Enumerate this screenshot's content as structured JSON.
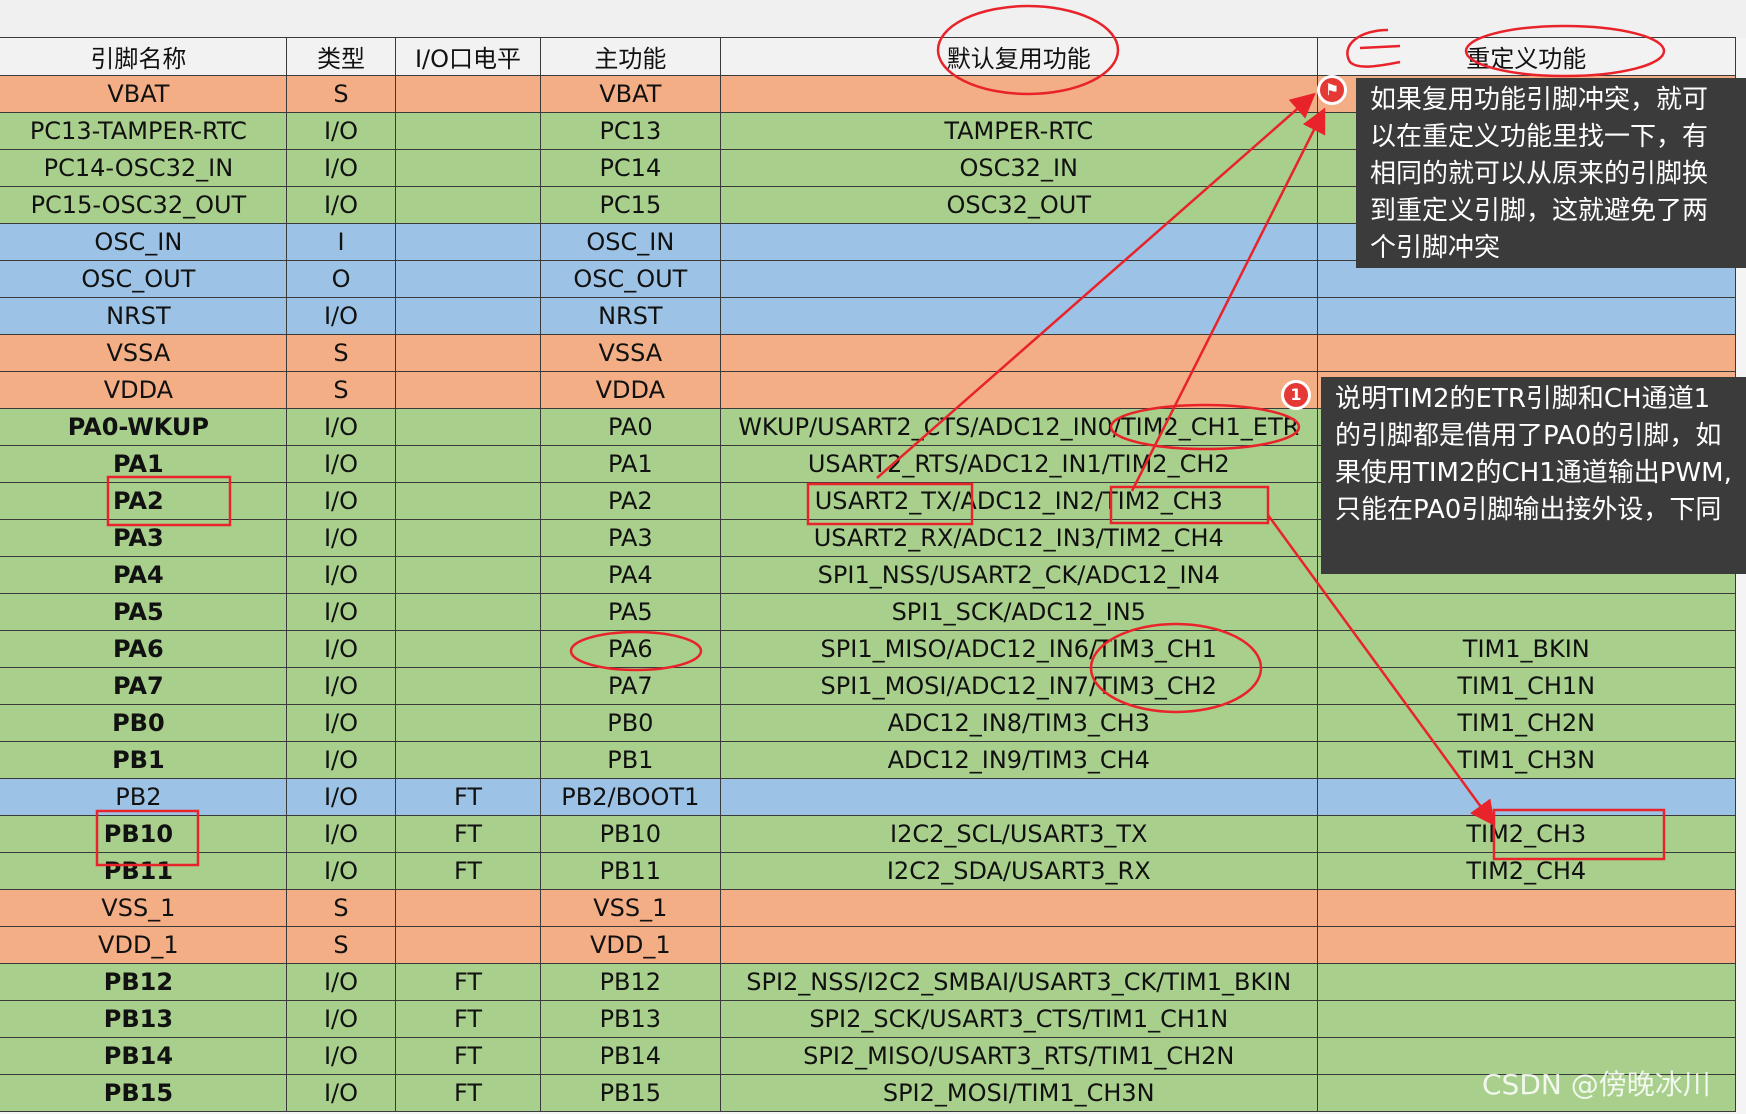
{
  "table": {
    "headers": [
      "引脚名称",
      "类型",
      "I/O口电平",
      "主功能",
      "默认复用功能",
      "重定义功能"
    ],
    "rows": [
      {
        "c": "orange",
        "name": "VBAT",
        "type": "S",
        "level": "",
        "main": "VBAT",
        "alt": "",
        "remap": ""
      },
      {
        "c": "green",
        "name": "PC13-TAMPER-RTC",
        "type": "I/O",
        "level": "",
        "main": "PC13",
        "alt": "TAMPER-RTC",
        "remap": ""
      },
      {
        "c": "green",
        "name": "PC14-OSC32_IN",
        "type": "I/O",
        "level": "",
        "main": "PC14",
        "alt": "OSC32_IN",
        "remap": ""
      },
      {
        "c": "green",
        "name": "PC15-OSC32_OUT",
        "type": "I/O",
        "level": "",
        "main": "PC15",
        "alt": "OSC32_OUT",
        "remap": ""
      },
      {
        "c": "blue",
        "name": "OSC_IN",
        "type": "I",
        "level": "",
        "main": "OSC_IN",
        "alt": "",
        "remap": ""
      },
      {
        "c": "blue",
        "name": "OSC_OUT",
        "type": "O",
        "level": "",
        "main": "OSC_OUT",
        "alt": "",
        "remap": ""
      },
      {
        "c": "blue",
        "name": "NRST",
        "type": "I/O",
        "level": "",
        "main": "NRST",
        "alt": "",
        "remap": ""
      },
      {
        "c": "orange",
        "name": "VSSA",
        "type": "S",
        "level": "",
        "main": "VSSA",
        "alt": "",
        "remap": ""
      },
      {
        "c": "orange",
        "name": "VDDA",
        "type": "S",
        "level": "",
        "main": "VDDA",
        "alt": "",
        "remap": ""
      },
      {
        "c": "green",
        "name": "PA0-WKUP",
        "type": "I/O",
        "level": "",
        "main": "PA0",
        "alt": "WKUP/USART2_CTS/ADC12_IN0/TIM2_CH1_ETR",
        "remap": "",
        "b": true
      },
      {
        "c": "green",
        "name": "PA1",
        "type": "I/O",
        "level": "",
        "main": "PA1",
        "alt": "USART2_RTS/ADC12_IN1/TIM2_CH2",
        "remap": "",
        "b": true
      },
      {
        "c": "green",
        "name": "PA2",
        "type": "I/O",
        "level": "",
        "main": "PA2",
        "alt": "USART2_TX/ADC12_IN2/TIM2_CH3",
        "remap": "",
        "b": true
      },
      {
        "c": "green",
        "name": "PA3",
        "type": "I/O",
        "level": "",
        "main": "PA3",
        "alt": "USART2_RX/ADC12_IN3/TIM2_CH4",
        "remap": "",
        "b": true
      },
      {
        "c": "green",
        "name": "PA4",
        "type": "I/O",
        "level": "",
        "main": "PA4",
        "alt": "SPI1_NSS/USART2_CK/ADC12_IN4",
        "remap": "",
        "b": true
      },
      {
        "c": "green",
        "name": "PA5",
        "type": "I/O",
        "level": "",
        "main": "PA5",
        "alt": "SPI1_SCK/ADC12_IN5",
        "remap": "",
        "b": true
      },
      {
        "c": "green",
        "name": "PA6",
        "type": "I/O",
        "level": "",
        "main": "PA6",
        "alt": "SPI1_MISO/ADC12_IN6/TIM3_CH1",
        "remap": "TIM1_BKIN",
        "b": true
      },
      {
        "c": "green",
        "name": "PA7",
        "type": "I/O",
        "level": "",
        "main": "PA7",
        "alt": "SPI1_MOSI/ADC12_IN7/TIM3_CH2",
        "remap": "TIM1_CH1N",
        "b": true
      },
      {
        "c": "green",
        "name": "PB0",
        "type": "I/O",
        "level": "",
        "main": "PB0",
        "alt": "ADC12_IN8/TIM3_CH3",
        "remap": "TIM1_CH2N",
        "b": true
      },
      {
        "c": "green",
        "name": "PB1",
        "type": "I/O",
        "level": "",
        "main": "PB1",
        "alt": "ADC12_IN9/TIM3_CH4",
        "remap": "TIM1_CH3N",
        "b": true
      },
      {
        "c": "blue",
        "name": "PB2",
        "type": "I/O",
        "level": "FT",
        "main": "PB2/BOOT1",
        "alt": "",
        "remap": ""
      },
      {
        "c": "green",
        "name": "PB10",
        "type": "I/O",
        "level": "FT",
        "main": "PB10",
        "alt": "I2C2_SCL/USART3_TX",
        "remap": "TIM2_CH3",
        "b": true
      },
      {
        "c": "green",
        "name": "PB11",
        "type": "I/O",
        "level": "FT",
        "main": "PB11",
        "alt": "I2C2_SDA/USART3_RX",
        "remap": "TIM2_CH4",
        "b": true
      },
      {
        "c": "orange",
        "name": "VSS_1",
        "type": "S",
        "level": "",
        "main": "VSS_1",
        "alt": "",
        "remap": ""
      },
      {
        "c": "orange",
        "name": "VDD_1",
        "type": "S",
        "level": "",
        "main": "VDD_1",
        "alt": "",
        "remap": ""
      },
      {
        "c": "green",
        "name": "PB12",
        "type": "I/O",
        "level": "FT",
        "main": "PB12",
        "alt": "SPI2_NSS/I2C2_SMBAI/USART3_CK/TIM1_BKIN",
        "remap": "",
        "b": true
      },
      {
        "c": "green",
        "name": "PB13",
        "type": "I/O",
        "level": "FT",
        "main": "PB13",
        "alt": "SPI2_SCK/USART3_CTS/TIM1_CH1N",
        "remap": "",
        "b": true
      },
      {
        "c": "green",
        "name": "PB14",
        "type": "I/O",
        "level": "FT",
        "main": "PB14",
        "alt": "SPI2_MISO/USART3_RTS/TIM1_CH2N",
        "remap": "",
        "b": true
      },
      {
        "c": "green",
        "name": "PB15",
        "type": "I/O",
        "level": "FT",
        "main": "PB15",
        "alt": "SPI2_MOSI/TIM1_CH3N",
        "remap": "",
        "b": true
      }
    ]
  },
  "annotations": {
    "note1": "如果复用功能引脚冲突，就可以在重定义功能里找一下，有相同的就可以从原来的引脚换到重定义引脚，这就避免了两个引脚冲突",
    "note2": "说明TIM2的ETR引脚和CH通道1的引脚都是借用了PA0的引脚，如果使用TIM2的CH1通道输出PWM,只能在PA0引脚输出接外设，下同",
    "badge1_icon": "flag-icon",
    "badge2": "1",
    "markup_color": "#e8232a"
  },
  "watermark": "CSDN @傍晚冰川",
  "colors": {
    "orange": "#f4ae86",
    "green": "#a9cf8c",
    "blue": "#9cc3e6",
    "note_bg": "#3b3b3b"
  }
}
